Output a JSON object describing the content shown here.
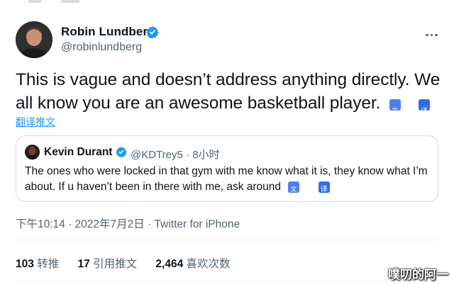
{
  "author": {
    "name": "Robin Lundberg",
    "handle": "@robinlundberg"
  },
  "tweet": {
    "text": "This is vague and doesn’t address anything directly. We all know you are an awesome basketball player.",
    "translate_link": "翻译推文"
  },
  "quoted": {
    "name": "Kevin Durant",
    "handle": "@KDTrey5",
    "separator": "·",
    "time": "8小时",
    "text": "The ones who were locked in that gym with me know what it is, they know what I’m about. If u haven’t been in there with me, ask around"
  },
  "timestamp": "下午10:14 · 2022年7月2日 · Twitter for iPhone",
  "stats": {
    "retweets_count": "103",
    "retweets_label": "转推",
    "quotes_count": "17",
    "quotes_label": "引用推文",
    "likes_count": "2,464",
    "likes_label": "喜欢次数"
  },
  "watermark": "噗叨的阿一",
  "colors": {
    "link": "#1d9bf0",
    "secondary_text": "#536471",
    "border": "#cfd9de",
    "verified": "#1d9bf0"
  },
  "icons": [
    "verified-badge-icon",
    "more-options-icon",
    "google-translate-icon",
    "translate-icon"
  ]
}
